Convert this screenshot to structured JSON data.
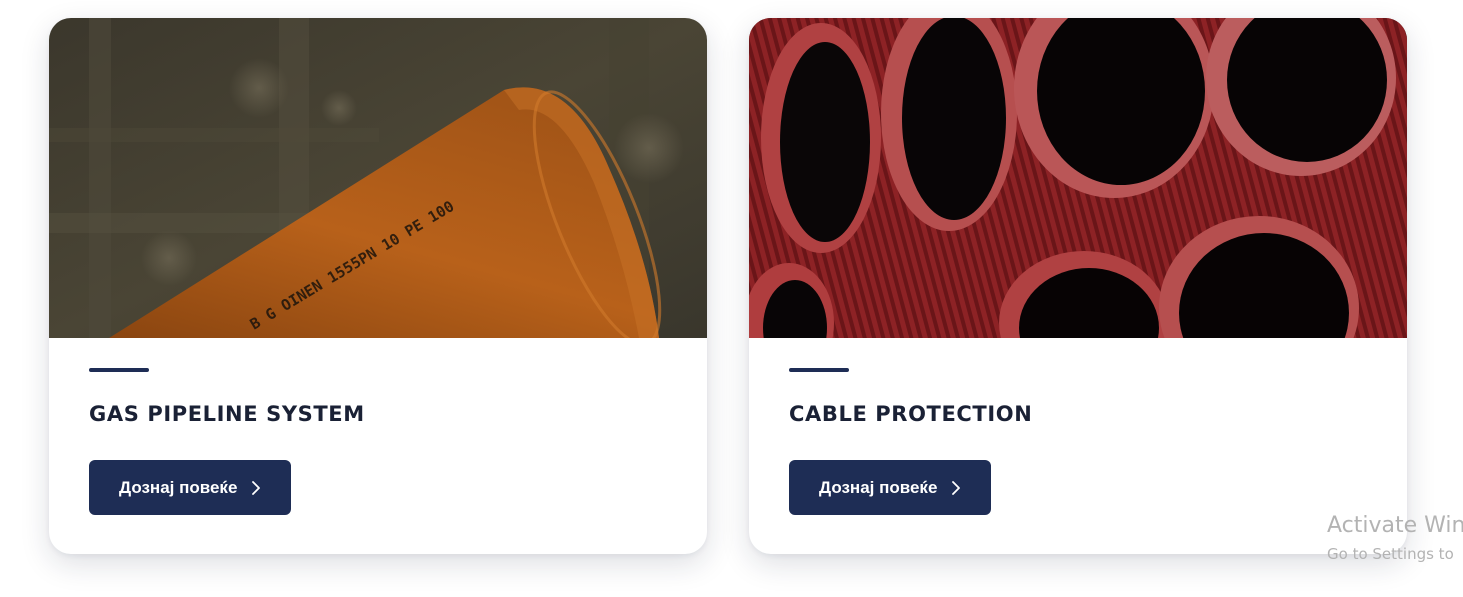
{
  "cards": [
    {
      "title": "GAS PIPELINE SYSTEM",
      "button_label": "Дознај повеќе",
      "image_icon": "orange-pipe-photo",
      "pipe_print": "B G OINEN 1555PN 10 PE 100"
    },
    {
      "title": "CABLE PROTECTION",
      "button_label": "Дознај повеќе",
      "image_icon": "red-corrugated-pipes-photo"
    }
  ],
  "watermark": {
    "title": "Activate Win",
    "subtitle": "Go to Settings to"
  },
  "colors": {
    "accent": "#1e2d55",
    "title_text": "#1a2135",
    "pipe_orange": "#b8611a",
    "pipe_red": "#b3282d"
  }
}
